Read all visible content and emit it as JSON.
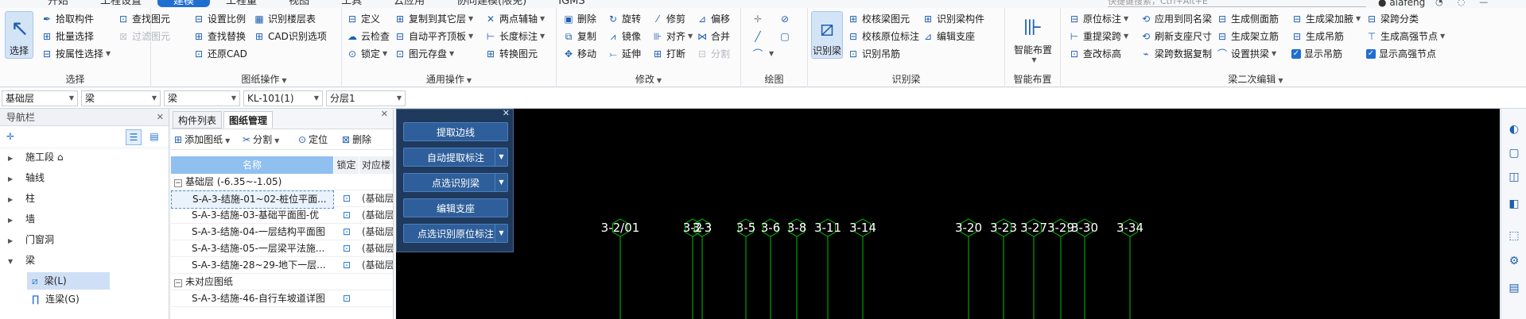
{
  "tabs": [
    "开始",
    "工程设置",
    "建模",
    "工程量",
    "视图",
    "工具",
    "云应用",
    "协同建模(限免)",
    "IGMS"
  ],
  "active_tab": "建模",
  "search_placeholder": "快捷键搜索，Ctrl+Alt+E",
  "username": "alafeng",
  "ribbon": {
    "select": {
      "big_label": "选择",
      "items": [
        "拾取构件",
        "批量选择",
        "按属性选择",
        "查找图元",
        "过滤图元"
      ],
      "label": "选择"
    },
    "drawing_ops": {
      "items": [
        "设置比例",
        "查找替换",
        "还原CAD",
        "识别楼层表",
        "CAD识别选项"
      ],
      "label": "图纸操作"
    },
    "common_ops": {
      "items": [
        "定义",
        "云检查",
        "锁定",
        "复制到其它层",
        "自动平齐顶板",
        "图元存盘",
        "两点辅轴",
        "长度标注",
        "转换图元"
      ],
      "label": "通用操作"
    },
    "modify": {
      "items": [
        "删除",
        "旋转",
        "修剪",
        "偏移",
        "复制",
        "镜像",
        "对齐",
        "合并",
        "移动",
        "延伸",
        "打断",
        "分割"
      ],
      "label": "修改"
    },
    "draw": {
      "label": "绘图"
    },
    "identify_beam": {
      "big_label": "识别梁",
      "items": [
        "校核梁图元",
        "校核原位标注",
        "识别吊筋",
        "识别梁构件",
        "编辑支座"
      ],
      "label": "识别梁"
    },
    "smart_layout": {
      "big_label": "智能布置",
      "label": "智能布置"
    },
    "beam_second_edit": {
      "items": [
        "原位标注",
        "重提梁跨",
        "查改标高",
        "应用到同名梁",
        "刷新支座尺寸",
        "梁跨数据复制",
        "生成侧面筋",
        "生成架立筋",
        "设置拱梁",
        "生成梁加腋",
        "生成吊筋",
        "显示吊筋",
        "梁跨分类",
        "生成高强节点",
        "显示高强节点"
      ],
      "label": "梁二次编辑"
    }
  },
  "filters": [
    "基础层",
    "梁",
    "梁",
    "KL-101(1)",
    "分层1"
  ],
  "nav": {
    "title": "导航栏",
    "items": [
      "施工段 ⌂",
      "轴线",
      "柱",
      "墙",
      "门窗洞",
      "梁"
    ],
    "sub_items": [
      "梁(L)",
      "连梁(G)"
    ]
  },
  "dwg_panel": {
    "tabs": [
      "构件列表",
      "图纸管理"
    ],
    "tools": [
      "添加图纸",
      "分割",
      "定位",
      "删除"
    ],
    "headers": [
      "名称",
      "锁定",
      "对应楼"
    ],
    "group1": "基础层 (-6.35~-1.05)",
    "rows": [
      {
        "name": "S-A-3-结施-01~02-桩位平面...",
        "floor": "(基础层"
      },
      {
        "name": "S-A-3-结施-03-基础平面图-优",
        "floor": "(基础层"
      },
      {
        "name": "S-A-3-结施-04-一层结构平面图",
        "floor": "(基础层"
      },
      {
        "name": "S-A-3-结施-05-一层梁平法施...",
        "floor": "(基础层"
      },
      {
        "name": "S-A-3-结施-28~29-地下一层...",
        "floor": "(基础层"
      }
    ],
    "group2": "未对应图纸",
    "rows2": [
      {
        "name": "S-A-3-结施-46-自行车坡道详图",
        "floor": ""
      }
    ]
  },
  "float_panel": {
    "buttons": [
      "提取边线",
      "自动提取标注",
      "点选识别梁",
      "编辑支座",
      "点选识别原位标注"
    ]
  },
  "axis_labels": [
    "3-2/01",
    "3-2",
    "3-3",
    "3-5",
    "3-6",
    "3-8",
    "3-11",
    "3-14",
    "3-20",
    "3-23",
    "3-27",
    "3-29",
    "3-30",
    "3-34"
  ],
  "colors": {
    "accent": "#1f6fd0",
    "canvas_bg": "#000000",
    "axis_line": "#00c000",
    "axis_text": "#ffffff"
  }
}
